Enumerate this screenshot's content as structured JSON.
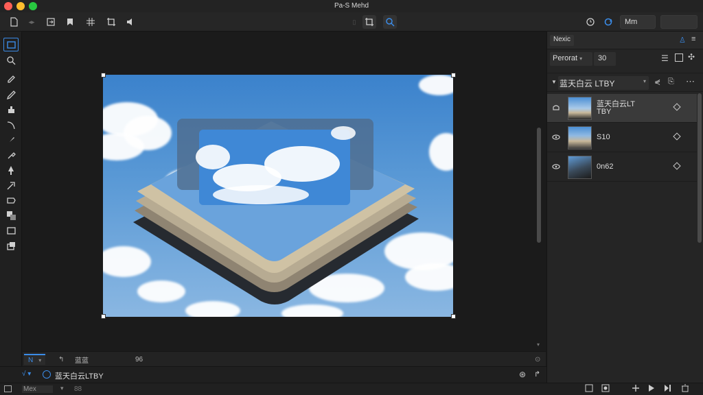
{
  "app": {
    "window_title": "Pa-S Mehd"
  },
  "toolbar": {
    "right_field": "Mm",
    "right_value": ""
  },
  "panel": {
    "tab_label": "Nexic",
    "preset_label": "Perorat",
    "preset_value": "30",
    "group_name": "蓝天白云 LTBY",
    "layers": [
      {
        "name": "蓝天白云LT",
        "name2": "TBY",
        "selected": true
      },
      {
        "name": "S10",
        "selected": false
      },
      {
        "name": "0n62",
        "selected": false
      }
    ]
  },
  "canvas_tabs": {
    "tab1": "N",
    "tab2": "蓝蓝",
    "tab3": "96"
  },
  "status": {
    "layer_label": "蓝天白云LTBY"
  },
  "bottombar": {
    "label": "Mex",
    "value": "88"
  },
  "colors": {
    "accent": "#3b8ce8",
    "background": "#1a1a1a",
    "panel": "#252525"
  }
}
